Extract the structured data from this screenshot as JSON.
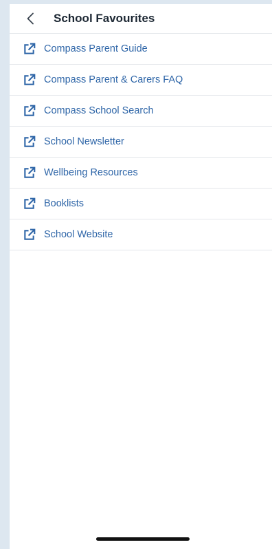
{
  "header": {
    "title": "School Favourites",
    "back_icon": "chevron-left-icon"
  },
  "links": {
    "icon": "external-link-icon",
    "items": [
      {
        "label": "Compass Parent Guide"
      },
      {
        "label": "Compass Parent & Carers FAQ"
      },
      {
        "label": "Compass School Search"
      },
      {
        "label": "School Newsletter"
      },
      {
        "label": "Wellbeing Resources"
      },
      {
        "label": "Booklists"
      },
      {
        "label": "School Website"
      }
    ]
  },
  "colors": {
    "link": "#2f66a8",
    "title": "#1c2733",
    "background": "#dde7f0",
    "divider": "#e3e6ea"
  }
}
